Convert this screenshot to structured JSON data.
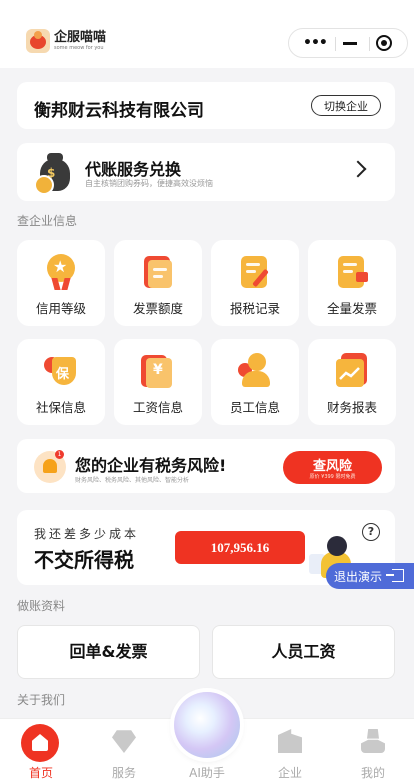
{
  "app": {
    "name": "企服喵喵",
    "tagline": "some meow for you"
  },
  "company": {
    "name": "衡邦财云科技有限公司",
    "switch_label": "切换企业"
  },
  "exchange": {
    "title": "代账服务兑换",
    "subtitle": "自主核销团购券码，便捷高效没烦恼"
  },
  "section_query": "查企业信息",
  "grid": [
    {
      "label": "信用等级",
      "icon": "credit-medal-icon"
    },
    {
      "label": "发票额度",
      "icon": "invoice-quota-icon"
    },
    {
      "label": "报税记录",
      "icon": "tax-record-icon"
    },
    {
      "label": "全量发票",
      "icon": "all-invoice-icon"
    },
    {
      "label": "社保信息",
      "icon": "social-insurance-icon"
    },
    {
      "label": "工资信息",
      "icon": "salary-icon"
    },
    {
      "label": "员工信息",
      "icon": "employee-icon"
    },
    {
      "label": "财务报表",
      "icon": "finance-report-icon"
    }
  ],
  "risk": {
    "badge": "1",
    "title": "您的企业有税务风险!",
    "subtitle": "财务风险、税务风险、其他风险、智能分析",
    "button": "查风险",
    "button_sub": "原价 ¥399 限时免费"
  },
  "tax": {
    "question": "我还差多少成本",
    "headline": "不交所得税",
    "amount": "107,956.16"
  },
  "exit_demo": "退出演示",
  "section_books": "做账资料",
  "actions": [
    "回单&发票",
    "人员工资"
  ],
  "section_about": "关于我们",
  "tabs": [
    {
      "label": "首页",
      "active": true
    },
    {
      "label": "服务",
      "active": false
    },
    {
      "label": "AI助手",
      "active": false
    },
    {
      "label": "企业",
      "active": false
    },
    {
      "label": "我的",
      "active": false
    }
  ],
  "colors": {
    "accent": "#ef3322",
    "demo": "#4f6bd8",
    "gold": "#f6b53d"
  }
}
